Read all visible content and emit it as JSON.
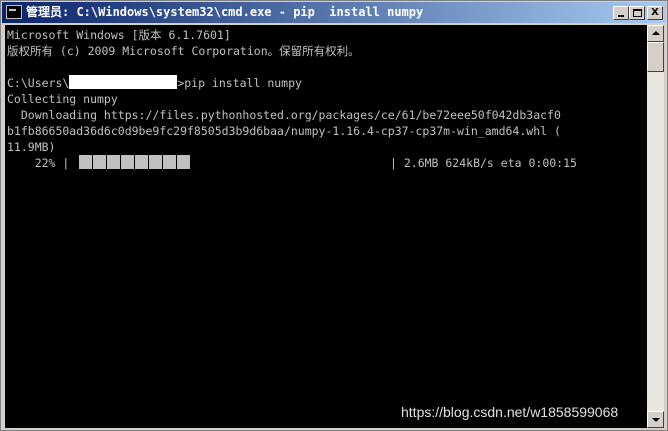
{
  "window": {
    "title": "管理员: C:\\Windows\\system32\\cmd.exe - pip  install numpy",
    "controls": {
      "minimize": "minimize",
      "maximize": "maximize",
      "close": "X"
    }
  },
  "console": {
    "lines": [
      "Microsoft Windows [版本 6.1.7601]",
      "版权所有 (c) 2009 Microsoft Corporation。保留所有权利。",
      "",
      "",
      "Collecting numpy",
      "  Downloading https://files.pythonhosted.org/packages/ce/61/be72eee50f042db3acf0",
      "b1fb86650ad36d6c0d9be9fc29f8505d3b9d6baa/numpy-1.16.4-cp37-cp37m-win_amd64.whl (",
      "11.9MB)"
    ],
    "prompt": {
      "prefix": "C:\\Users\\",
      "command": ">pip install numpy"
    },
    "progress": {
      "percent_label": "    22% |",
      "fraction": 0.22,
      "segments_filled": 8,
      "stats": "| 2.6MB 624kB/s eta 0:00:15"
    }
  },
  "watermark": "https://blog.csdn.net/w1858599068"
}
